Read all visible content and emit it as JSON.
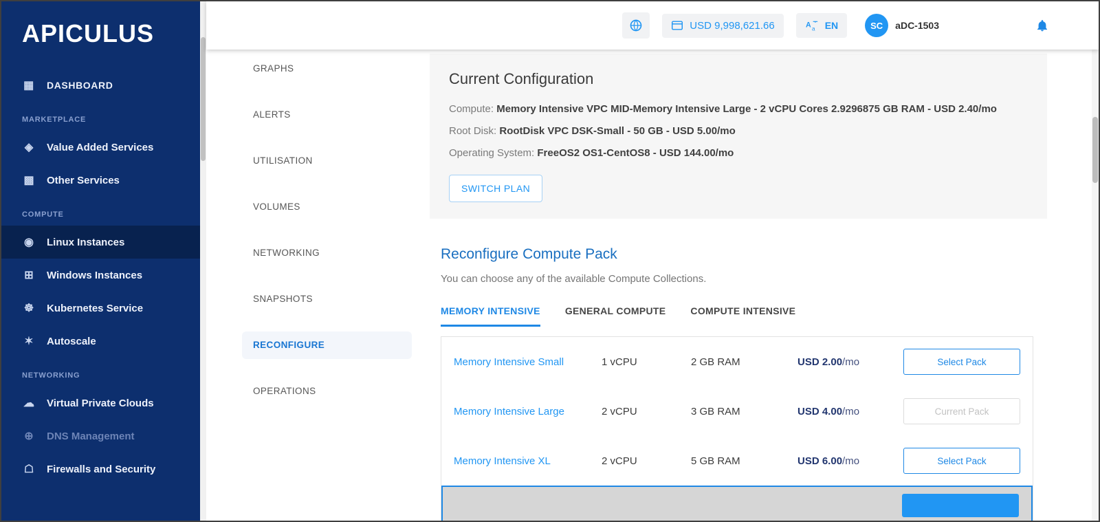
{
  "brand": {
    "logo": "APICULUS"
  },
  "topbar": {
    "balance": "USD 9,998,621.66",
    "language": "EN",
    "avatar_initials": "SC",
    "account_name": "aDC-1503"
  },
  "sidebar": {
    "groups": [
      {
        "items": [
          {
            "label": "DASHBOARD",
            "glyph": "▦"
          }
        ]
      },
      {
        "header": "MARKETPLACE",
        "items": [
          {
            "label": "Value Added Services",
            "glyph": "◈"
          },
          {
            "label": "Other Services",
            "glyph": "▩"
          }
        ]
      },
      {
        "header": "COMPUTE",
        "items": [
          {
            "label": "Linux Instances",
            "glyph": "◉"
          },
          {
            "label": "Windows Instances",
            "glyph": "⊞"
          },
          {
            "label": "Kubernetes Service",
            "glyph": "☸"
          },
          {
            "label": "Autoscale",
            "glyph": "✶"
          }
        ]
      },
      {
        "header": "NETWORKING",
        "items": [
          {
            "label": "Virtual Private Clouds",
            "glyph": "☁"
          },
          {
            "label": "DNS Management",
            "glyph": "⊕"
          },
          {
            "label": "Firewalls and Security",
            "glyph": "☖"
          }
        ]
      }
    ]
  },
  "subnav": {
    "items": [
      "GRAPHS",
      "ALERTS",
      "UTILISATION",
      "VOLUMES",
      "NETWORKING",
      "SNAPSHOTS",
      "RECONFIGURE",
      "OPERATIONS"
    ]
  },
  "current_config": {
    "title": "Current Configuration",
    "compute_label": "Compute: ",
    "compute_value": "Memory Intensive VPC MID-Memory Intensive Large - 2 vCPU Cores 2.9296875 GB RAM - USD 2.40/mo",
    "root_disk_label": "Root Disk: ",
    "root_disk_value": "RootDisk VPC DSK-Small - 50 GB - USD 5.00/mo",
    "os_label": "Operating System: ",
    "os_value": "FreeOS2 OS1-CentOS8 - USD 144.00/mo",
    "switch_plan": "SWITCH PLAN"
  },
  "reconfigure": {
    "title": "Reconfigure Compute Pack",
    "subtitle": "You can choose any of the available Compute Collections.",
    "tabs": [
      "MEMORY INTENSIVE",
      "GENERAL COMPUTE",
      "COMPUTE INTENSIVE"
    ],
    "packs": [
      {
        "name": "Memory Intensive Small",
        "cpu": "1 vCPU",
        "ram": "2 GB RAM",
        "price": "USD 2.00",
        "per": "/mo",
        "action": "Select Pack"
      },
      {
        "name": "Memory Intensive Large",
        "cpu": "2 vCPU",
        "ram": "3 GB RAM",
        "price": "USD 4.00",
        "per": "/mo",
        "action": "Current Pack"
      },
      {
        "name": "Memory Intensive XL",
        "cpu": "2 vCPU",
        "ram": "5 GB RAM",
        "price": "USD 6.00",
        "per": "/mo",
        "action": "Select Pack"
      }
    ]
  }
}
